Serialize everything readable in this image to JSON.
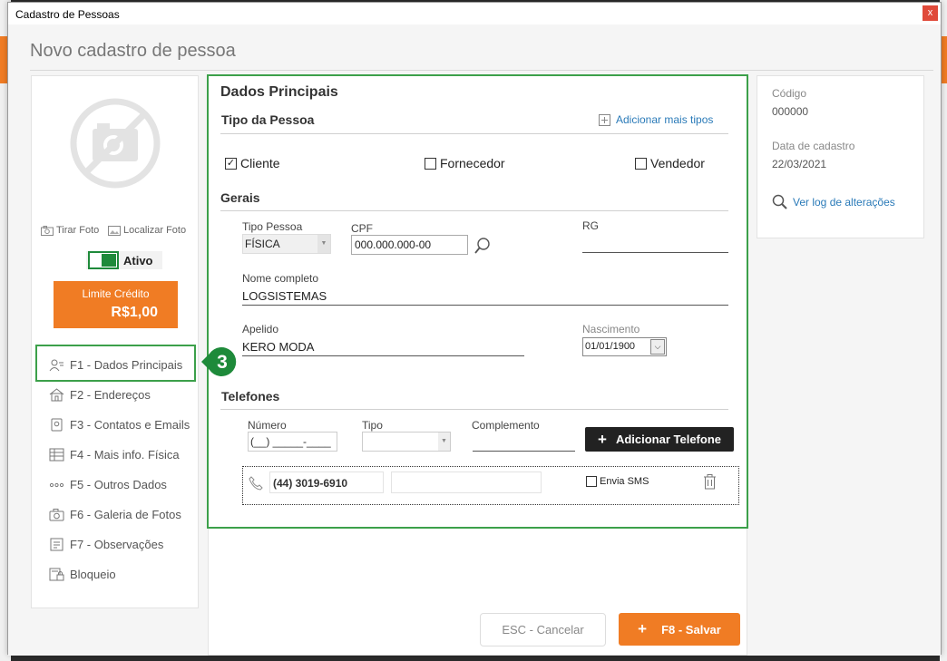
{
  "window": {
    "title": "Cadastro de Pessoas",
    "close_glyph": "x"
  },
  "page_title": "Novo cadastro de pessoa",
  "left": {
    "take_photo": "Tirar Foto",
    "find_photo": "Localizar Foto",
    "status_label": "Ativo",
    "status_on": true,
    "credit_label": "Limite Crédito",
    "credit_value": "R$1,00",
    "nav": [
      {
        "label": "F1 - Dados Principais",
        "icon": "user-card-icon"
      },
      {
        "label": "F2 - Endereços",
        "icon": "home-icon"
      },
      {
        "label": "F3 - Contatos e Emails",
        "icon": "contact-icon"
      },
      {
        "label": "F4 - Mais info. Física",
        "icon": "table-icon"
      },
      {
        "label": "F5 - Outros Dados",
        "icon": "dots-icon"
      },
      {
        "label": "F6 - Galeria de Fotos",
        "icon": "camera-icon"
      },
      {
        "label": "F7 - Observações",
        "icon": "note-icon"
      },
      {
        "label": "Bloqueio",
        "icon": "lock-doc-icon"
      }
    ],
    "callout_number": "3"
  },
  "main": {
    "heading": "Dados Principais",
    "tipo_pessoa": {
      "heading": "Tipo da Pessoa",
      "add_types": "Adicionar mais tipos",
      "options": [
        {
          "label": "Cliente",
          "checked": true
        },
        {
          "label": "Fornecedor",
          "checked": false
        },
        {
          "label": "Vendedor",
          "checked": false
        }
      ]
    },
    "gerais": {
      "heading": "Gerais",
      "tipo_label": "Tipo Pessoa",
      "tipo_value": "FÍSICA",
      "cpf_label": "CPF",
      "cpf_value": "000.000.000-00",
      "rg_label": "RG",
      "rg_value": "",
      "nome_label": "Nome completo",
      "nome_value": "LOGSISTEMAS",
      "apelido_label": "Apelido",
      "apelido_value": "KERO MODA",
      "nascimento_label": "Nascimento",
      "nascimento_value": "01/01/1900"
    },
    "telefones": {
      "heading": "Telefones",
      "numero_label": "Número",
      "numero_placeholder": "(__) _____-____",
      "tipo_label": "Tipo",
      "complemento_label": "Complemento",
      "add_button": "Adicionar Telefone",
      "phones": [
        {
          "number": "(44) 3019-6910",
          "complement": "",
          "sms_label": "Envia SMS",
          "sms": false
        }
      ]
    }
  },
  "info": {
    "code_label": "Código",
    "code_value": "000000",
    "date_label": "Data de cadastro",
    "date_value": "22/03/2021",
    "log_link": "Ver log de alterações"
  },
  "footer": {
    "cancel": "ESC - Cancelar",
    "save": "F8 - Salvar"
  },
  "colors": {
    "accent": "#f07c24",
    "highlight": "#3ca04a",
    "link": "#2a7ab8",
    "toggle": "#1e8a3a"
  }
}
